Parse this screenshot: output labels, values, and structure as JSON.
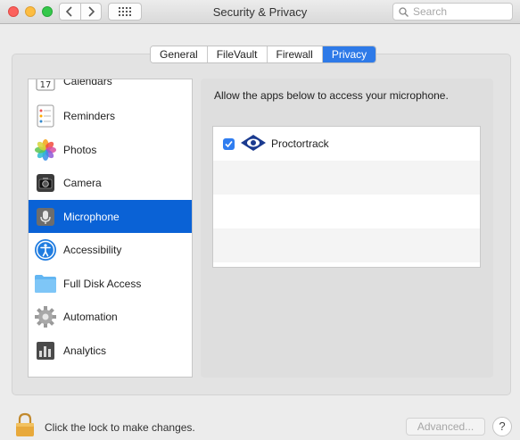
{
  "window": {
    "title": "Security & Privacy",
    "search_placeholder": "Search"
  },
  "tabs": [
    {
      "label": "General",
      "active": false
    },
    {
      "label": "FileVault",
      "active": false
    },
    {
      "label": "Firewall",
      "active": false
    },
    {
      "label": "Privacy",
      "active": true
    }
  ],
  "sidebar": {
    "items": [
      {
        "label": "Calendars",
        "icon": "calendar-icon",
        "icon_text": "17"
      },
      {
        "label": "Reminders",
        "icon": "reminders-icon"
      },
      {
        "label": "Photos",
        "icon": "photos-icon"
      },
      {
        "label": "Camera",
        "icon": "camera-icon"
      },
      {
        "label": "Microphone",
        "icon": "microphone-icon",
        "selected": true
      },
      {
        "label": "Accessibility",
        "icon": "accessibility-icon"
      },
      {
        "label": "Full Disk Access",
        "icon": "folder-icon"
      },
      {
        "label": "Automation",
        "icon": "gear-icon"
      },
      {
        "label": "Analytics",
        "icon": "analytics-icon"
      }
    ]
  },
  "pane": {
    "heading": "Allow the apps below to access your microphone.",
    "apps": [
      {
        "name": "Proctortrack",
        "checked": true,
        "icon": "proctortrack-eye-icon"
      }
    ]
  },
  "footer": {
    "lock_text": "Click the lock to make changes.",
    "advanced_label": "Advanced...",
    "help_label": "?"
  },
  "colors": {
    "accent": "#2e7ae8",
    "selection": "#0a62d6"
  }
}
